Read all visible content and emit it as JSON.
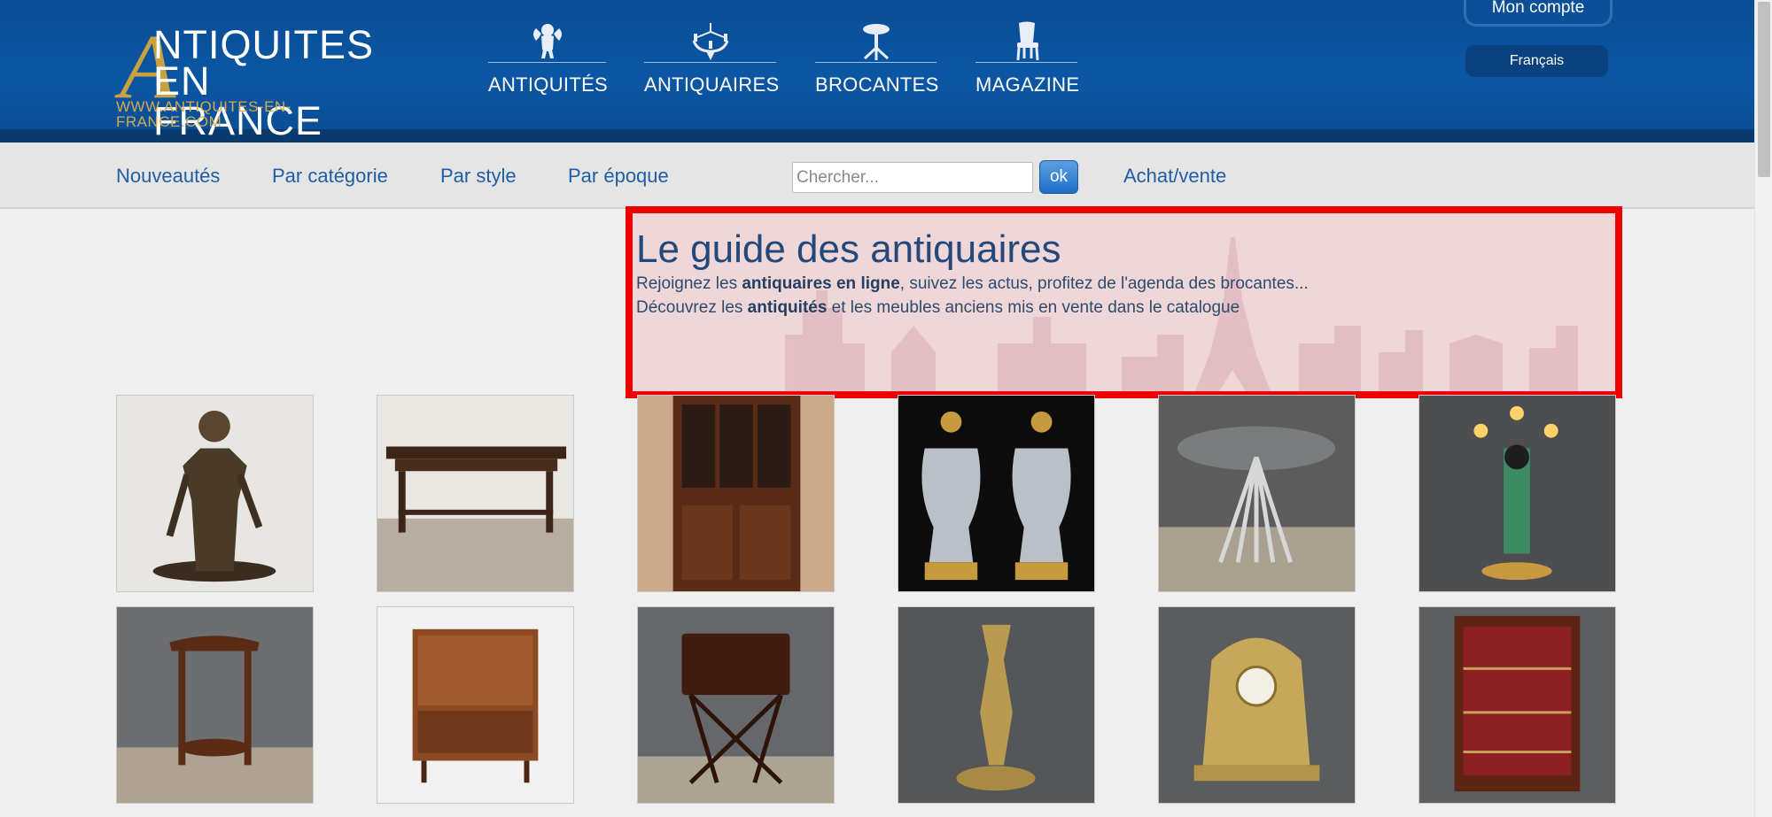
{
  "logo": {
    "line1": "NTIQUITES",
    "line2": "EN FRANCE",
    "letter": "A",
    "url": "WWW.ANTIQUITES-EN-FRANCE.COM"
  },
  "main_nav": [
    {
      "label": "ANTIQUITÉS",
      "icon": "cherub-icon"
    },
    {
      "label": "ANTIQUAIRES",
      "icon": "chandelier-icon"
    },
    {
      "label": "BROCANTES",
      "icon": "pedestal-table-icon"
    },
    {
      "label": "MAGAZINE",
      "icon": "chair-icon"
    }
  ],
  "account": {
    "label": "Mon compte",
    "language": "Français"
  },
  "sub_nav": {
    "links": [
      "Nouveautés",
      "Par catégorie",
      "Par style",
      "Par époque"
    ],
    "search_placeholder": "Chercher...",
    "search_button": "ok",
    "achat_vente": "Achat/vente"
  },
  "intro": {
    "title": "Le guide des antiquaires",
    "line1_pre": "Rejoignez les ",
    "line1_bold": "antiquaires en ligne",
    "line1_post": ", suivez les actus, profitez de l'agenda des brocantes...",
    "line2_pre": "Découvrez les ",
    "line2_bold": "antiquités",
    "line2_post": " et les meubles anciens mis en vente dans le catalogue"
  },
  "products": [
    "bronze-knight-statue",
    "farmhouse-table",
    "display-cabinet",
    "marble-vase-pair",
    "wheat-sheaf-glass-table",
    "blackamoor-torchere",
    "twisted-side-table",
    "teak-sideboard",
    "sewing-table",
    "gilt-bronze-statue",
    "gilt-mantel-clock",
    "mahogany-vitrine"
  ],
  "colors": {
    "header_blue": "#0b56a3",
    "gold": "#c9a240",
    "link_blue": "#1f5ea6",
    "highlight_red": "#ee0000"
  }
}
